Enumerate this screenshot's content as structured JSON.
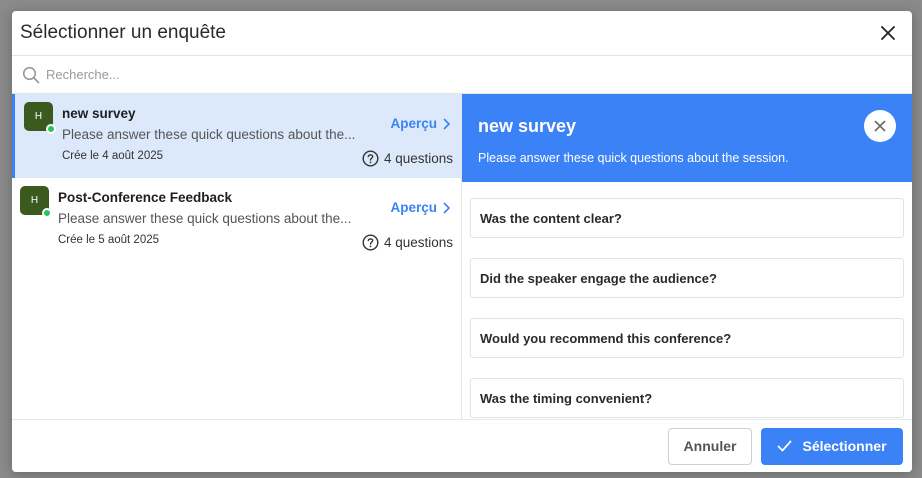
{
  "dialog": {
    "title": "Sélectionner un enquête"
  },
  "search": {
    "placeholder": "Recherche..."
  },
  "surveys": [
    {
      "avatar": "H",
      "title": "new survey",
      "description": "Please answer these quick questions about the...",
      "created": "Crée le 4 août 2025",
      "preview_label": "Aperçu",
      "count": "4 questions"
    },
    {
      "avatar": "H",
      "title": "Post-Conference Feedback",
      "description": "Please answer these quick questions about the...",
      "created": "Crée le 5 août 2025",
      "preview_label": "Aperçu",
      "count": "4 questions"
    }
  ],
  "preview": {
    "title": "new survey",
    "description": "Please answer these quick questions about the session.",
    "questions": [
      "Was the content clear?",
      "Did the speaker engage the audience?",
      "Would you recommend this conference?",
      "Was the timing convenient?"
    ]
  },
  "footer": {
    "cancel_label": "Annuler",
    "select_label": "Sélectionner"
  },
  "colors": {
    "accent": "#3b82f6",
    "selected_bg": "#dce9fb",
    "avatar_bg": "#3a5a1f",
    "status_dot": "#22c55e"
  }
}
